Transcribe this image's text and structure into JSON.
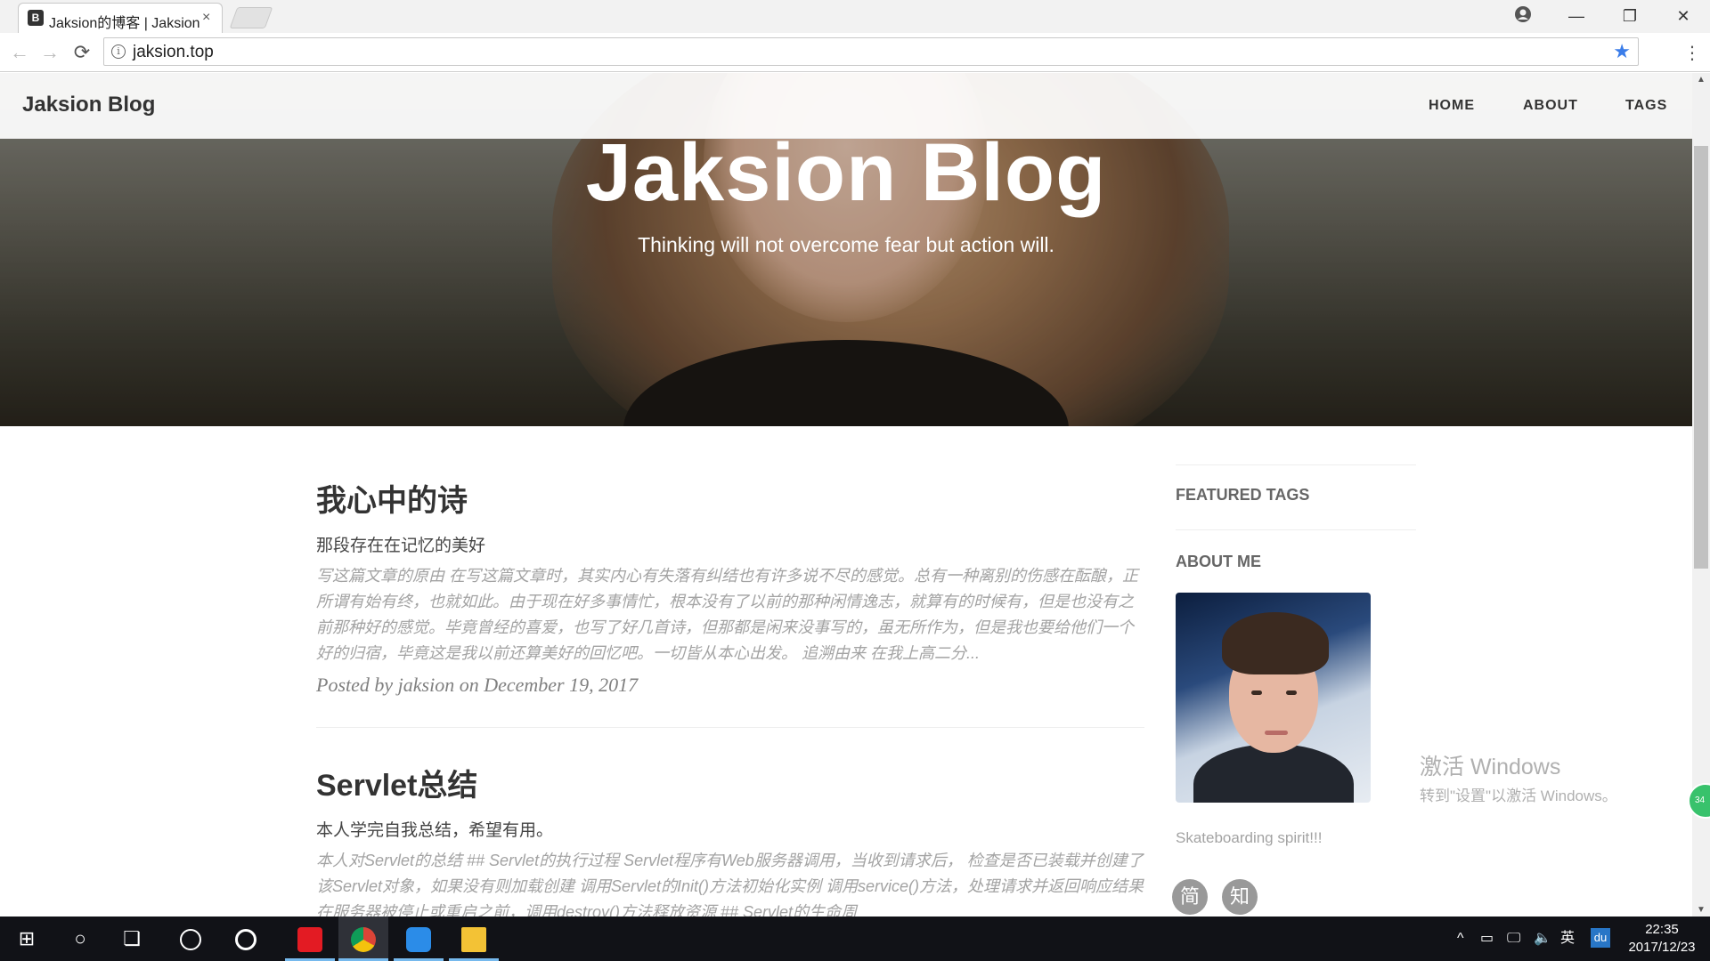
{
  "browser": {
    "tab_favicon": "B",
    "tab_title": "Jaksion的博客 | Jaksion",
    "tab_close": "×",
    "url": "jaksion.top",
    "window_controls": {
      "minimize": "—",
      "restore": "❐",
      "close": "✕"
    },
    "nav": {
      "back": "←",
      "forward": "→",
      "reload": "⟳"
    },
    "star": "★",
    "menu": "⋮",
    "info": "i"
  },
  "site": {
    "brand": "Jaksion Blog",
    "nav_links": [
      "HOME",
      "ABOUT",
      "TAGS"
    ],
    "hero_title": "Jaksion Blog",
    "hero_subtitle": "Thinking will not overcome fear but action will."
  },
  "posts": [
    {
      "title": "我心中的诗",
      "subtitle": "那段存在在记忆的美好",
      "excerpt": "写这篇文章的原由 在写这篇文章时，其实内心有失落有纠结也有许多说不尽的感觉。总有一种离别的伤感在酝酿，正所谓有始有终，也就如此。由于现在好多事情忙，根本没有了以前的那种闲情逸志，就算有的时候有，但是也没有之前那种好的感觉。毕竟曾经的喜爱，也写了好几首诗，但那都是闲来没事写的，虽无所作为，但是我也要给他们一个好的归宿，毕竟这是我以前还算美好的回忆吧。一切皆从本心出发。 追溯由来 在我上高二分...",
      "meta": "Posted by jaksion on December 19, 2017"
    },
    {
      "title": "Servlet总结",
      "subtitle": "本人学完自我总结，希望有用。",
      "excerpt": "本人对Servlet的总结 ## Servlet的执行过程 Servlet程序有Web服务器调用，当收到请求后， 检查是否已装载并创建了该Servlet对象，如果没有则加载创建 调用Servlet的Init()方法初始化实例 调用service()方法，处理请求并返回响应结果 在服务器被停止或重启之前，调用destroy()方法释放资源 ## Servlet的生命周"
    }
  ],
  "sidebar": {
    "featured_tags": "FEATURED TAGS",
    "about_me": "ABOUT ME",
    "about_text": "Skateboarding spirit!!!",
    "social": [
      "简",
      "知"
    ]
  },
  "watermark": {
    "line1": "激活 Windows",
    "line2": "转到\"设置\"以激活 Windows。"
  },
  "speed_badge": "34",
  "taskbar": {
    "start": "⊞",
    "cortana": "○",
    "taskview": "❏",
    "ime": "英",
    "du": "du",
    "time": "22:35",
    "date": "2017/12/23",
    "tray_chevron": "^",
    "tray_battery": "▭",
    "tray_network": "🖵",
    "tray_volume": "🔈"
  },
  "scrollbar": {
    "up": "▲",
    "down": "▼"
  }
}
